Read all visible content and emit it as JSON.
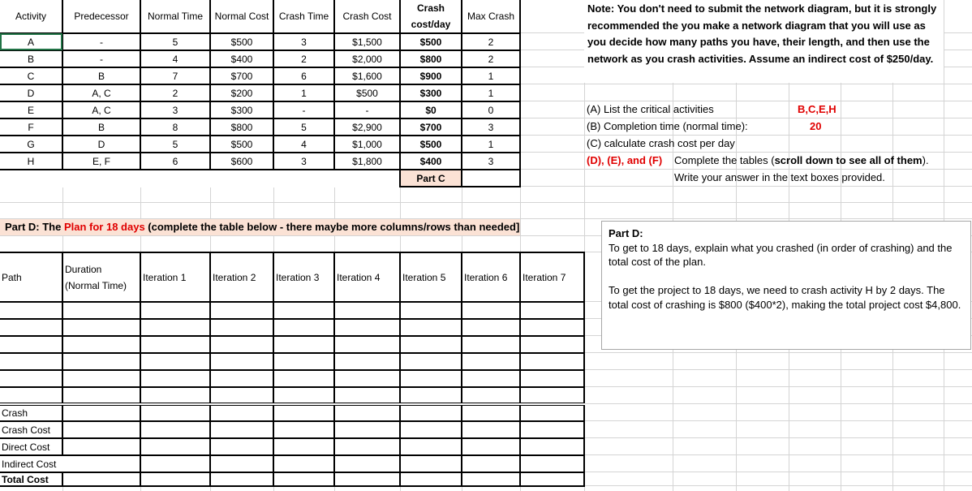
{
  "activity_table": {
    "headers": [
      "Activity",
      "Predecessor",
      "Normal Time",
      "Normal Cost",
      "Crash Time",
      "Crash Cost",
      "Crash cost/day",
      "Max Crash"
    ],
    "rows": [
      [
        "A",
        "-",
        "5",
        "$500",
        "3",
        "$1,500",
        "$500",
        "2"
      ],
      [
        "B",
        "-",
        "4",
        "$400",
        "2",
        "$2,000",
        "$800",
        "2"
      ],
      [
        "C",
        "B",
        "7",
        "$700",
        "6",
        "$1,600",
        "$900",
        "1"
      ],
      [
        "D",
        "A, C",
        "2",
        "$200",
        "1",
        "$500",
        "$300",
        "1"
      ],
      [
        "E",
        "A, C",
        "3",
        "$300",
        "-",
        "-",
        "$0",
        "0"
      ],
      [
        "F",
        "B",
        "8",
        "$800",
        "5",
        "$2,900",
        "$700",
        "3"
      ],
      [
        "G",
        "D",
        "5",
        "$500",
        "4",
        "$1,000",
        "$500",
        "1"
      ],
      [
        "H",
        "E, F",
        "6",
        "$600",
        "3",
        "$1,800",
        "$400",
        "3"
      ]
    ],
    "part_c_label": "Part C",
    "selected_cell": "A"
  },
  "note": "Note: You don't need to submit the network diagram, but it is strongly recommended the you make a network diagram that you will use as you decide how many paths you have, their length, and then use the network as you crash activities. Assume an indirect cost of $250/day.",
  "questions": {
    "a_label": "(A) List the critical activities",
    "a_answer": "B,C,E,H",
    "b_label": "(B) Completion time (normal time):",
    "b_answer": "20",
    "c_label": "(C) calculate crash cost per day",
    "def_label": "(D), (E), and (F)",
    "def_text_1": "Complete the tables (",
    "def_text_bold": "scroll down to see all of them",
    "def_text_2": ").",
    "def_text_line2": "Write your answer in the text boxes provided."
  },
  "part_d_banner": {
    "prefix": "Part D: The ",
    "highlight": "Plan for 18 days",
    "suffix": " (complete the table below - there maybe more columns/rows than needed]"
  },
  "iteration_table": {
    "headers": [
      "Path",
      "Duration (Normal Time)",
      "Iteration 1",
      "Iteration 2",
      "Iteration 3",
      "Iteration 4",
      "Iteration 5",
      "Iteration 6",
      "Iteration 7"
    ],
    "path_rows": [
      [
        "",
        "",
        "",
        "",
        "",
        "",
        "",
        "",
        ""
      ],
      [
        "",
        "",
        "",
        "",
        "",
        "",
        "",
        "",
        ""
      ],
      [
        "",
        "",
        "",
        "",
        "",
        "",
        "",
        "",
        ""
      ],
      [
        "",
        "",
        "",
        "",
        "",
        "",
        "",
        "",
        ""
      ],
      [
        "",
        "",
        "",
        "",
        "",
        "",
        "",
        "",
        ""
      ],
      [
        "",
        "",
        "",
        "",
        "",
        "",
        "",
        "",
        ""
      ]
    ],
    "summary_rows": [
      "Crash",
      "Crash Cost",
      "Direct Cost",
      "Indirect Cost",
      "Total Cost"
    ]
  },
  "part_d_textbox": {
    "title": "Part D:",
    "prompt": "To get to 18 days, explain what you crashed (in order of crashing) and the total cost of the plan.",
    "answer": "To get the project to 18 days, we need to crash activity H by 2 days. The total cost of crashing is $800 ($400*2), making the total project cost $4,800."
  }
}
